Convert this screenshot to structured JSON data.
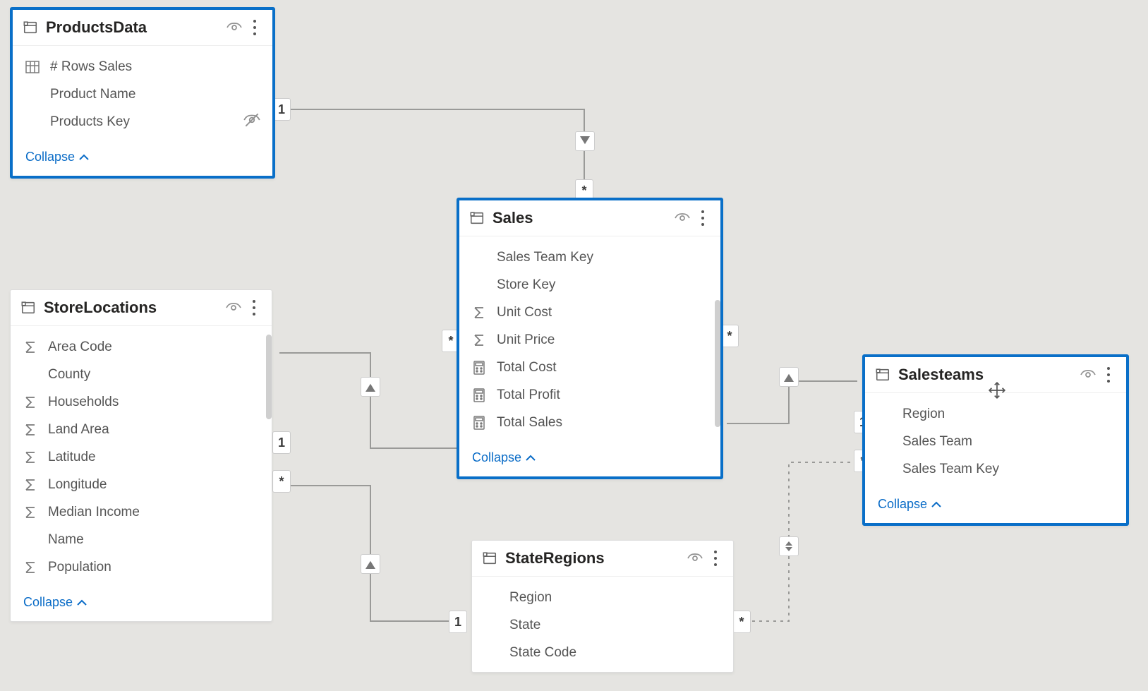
{
  "ui": {
    "collapse_label": "Collapse"
  },
  "tables": {
    "products": {
      "title": "ProductsData",
      "fields": {
        "rows_sales": "# Rows Sales",
        "product_name": "Product Name",
        "products_key": "Products Key"
      }
    },
    "sales": {
      "title": "Sales",
      "fields": {
        "sales_team_key": "Sales Team Key",
        "store_key": "Store Key",
        "unit_cost": "Unit Cost",
        "unit_price": "Unit Price",
        "total_cost": "Total Cost",
        "total_profit": "Total Profit",
        "total_sales": "Total Sales"
      }
    },
    "storelocations": {
      "title": "StoreLocations",
      "fields": {
        "area_code": "Area Code",
        "county": "County",
        "households": "Households",
        "land_area": "Land Area",
        "latitude": "Latitude",
        "longitude": "Longitude",
        "median_income": "Median Income",
        "name": "Name",
        "population": "Population"
      }
    },
    "stateregions": {
      "title": "StateRegions",
      "fields": {
        "region": "Region",
        "state": "State",
        "state_code": "State Code"
      }
    },
    "salesteams": {
      "title": "Salesteams",
      "fields": {
        "region": "Region",
        "sales_team": "Sales Team",
        "sales_team_key": "Sales Team Key"
      }
    }
  },
  "relationships": {
    "products_sales": {
      "from_card": "1",
      "to_card": "*"
    },
    "storelocations_sales": {
      "from_card": "1",
      "to_card": "*"
    },
    "storelocations_stateregions": {
      "from_card": "*",
      "to_card": "1"
    },
    "salesteams_sales": {
      "from_card": "1",
      "to_card": "*"
    },
    "salesteams_stateregions": {
      "from_card": "*",
      "to_card": "*"
    }
  }
}
